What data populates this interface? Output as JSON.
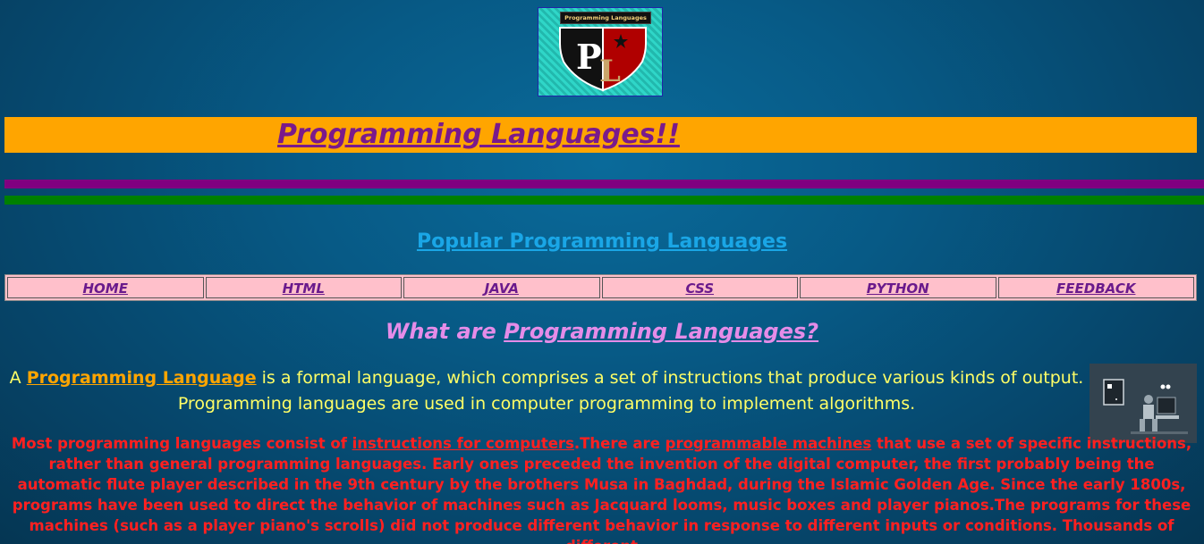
{
  "logo": {
    "banner_text": "Programming Languages",
    "letters": "PL",
    "colors": {
      "left": "#111111",
      "right": "#b00000",
      "background": "#2fd6c8"
    }
  },
  "header": {
    "title": "Programming Languages!!",
    "bar_color": "#ffa500"
  },
  "divider_colors": {
    "top": "#800080",
    "bottom": "#008000"
  },
  "subtitle": "Popular Programming Languages",
  "nav": {
    "items": [
      {
        "label": "HOME"
      },
      {
        "label": "HTML"
      },
      {
        "label": "JAVA"
      },
      {
        "label": "CSS"
      },
      {
        "label": "PYTHON"
      },
      {
        "label": "FEEDBACK"
      }
    ]
  },
  "section": {
    "question_prefix": "What are ",
    "question_link": "Programming Languages?",
    "intro_prefix": "A ",
    "intro_link": "Programming Language",
    "intro_rest": " is a formal language, which comprises a set of instructions that produce various kinds of output. Programming languages are used in computer programming to implement algorithms.",
    "detail_part1": "Most programming languages consist of ",
    "detail_link1": "instructions for computers",
    "detail_part2": ".There are ",
    "detail_link2": "programmable machines",
    "detail_part3": " that use a set of specific instructions, rather than general programming languages. Early ones preceded the invention of the digital computer, the first probably being the automatic flute player described in the 9th century by the brothers Musa in Baghdad, during the Islamic Golden Age. Since the early 1800s, programs have been used to direct the behavior of machines such as Jacquard looms, music boxes and player pianos.The programs for these machines (such as a player piano's scrolls) did not produce different behavior in response to different inputs or conditions. Thousands of different"
  },
  "side_image": {
    "icon": "programmer-at-computer-icon"
  }
}
